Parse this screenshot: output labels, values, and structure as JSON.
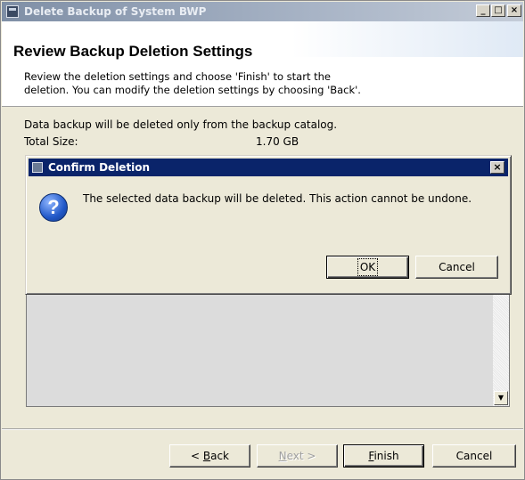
{
  "window": {
    "title": "Delete Backup of System BWP",
    "controls": {
      "minimize": "_",
      "maximize": "□",
      "close": "×"
    }
  },
  "header": {
    "title": "Review Backup Deletion Settings",
    "description_line1": "Review the deletion settings and choose 'Finish' to start the",
    "description_line2": "deletion. You can modify the deletion settings by choosing 'Back'."
  },
  "content": {
    "info_text": "Data backup will be deleted only from the backup catalog.",
    "total_size_label": "Total Size:",
    "total_size_value": "1.70 GB"
  },
  "footer": {
    "back": {
      "prefix": "< ",
      "mnemonic": "B",
      "rest": "ack"
    },
    "next": {
      "mnemonic": "N",
      "rest": "ext >"
    },
    "finish": {
      "mnemonic": "F",
      "rest": "inish"
    },
    "cancel": "Cancel"
  },
  "dialog": {
    "title": "Confirm Deletion",
    "message": "The selected data backup will be deleted. This action cannot be undone.",
    "icon_glyph": "?",
    "ok_label": "OK",
    "cancel_label": "Cancel",
    "close_glyph": "×"
  },
  "icons": {
    "app": "app-window-icon",
    "question": "question-icon",
    "scroll_down": "scroll-down-arrow-icon"
  },
  "colors": {
    "dialog_titlebar": "#0a246a",
    "main_titlebar": "#7f8fa6",
    "question_icon": "#2158c8"
  }
}
